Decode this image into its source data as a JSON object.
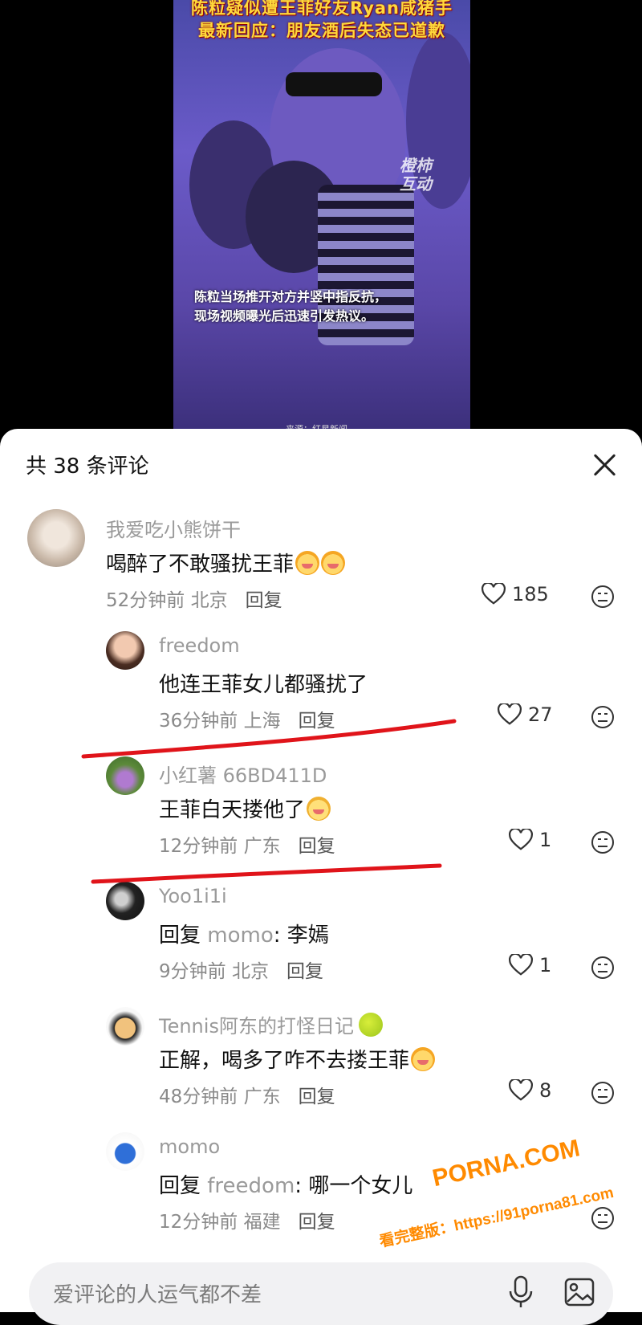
{
  "video": {
    "headline_1": "陈粒疑似遭王菲好友Ryan咸猪手",
    "headline_2": "最新回应：朋友酒后失态已道歉",
    "caption_1": "陈粒当场推开对方并竖中指反抗，",
    "caption_2": "现场视频曝光后迅速引发热议。",
    "watermark_1": "橙柿",
    "watermark_2": "互动",
    "source": "来源：红星新闻"
  },
  "sheet": {
    "title": "共 38 条评论",
    "close_icon": "close-icon"
  },
  "comments": [
    {
      "user": "我爱吃小熊饼干",
      "text": "喝醉了不敢骚扰王菲",
      "time": "52分钟前",
      "location": "北京",
      "reply": "回复",
      "likes": "185",
      "emoji_count": 2
    },
    {
      "user": "freedom",
      "text": "他连王菲女儿都骚扰了",
      "time": "36分钟前",
      "location": "上海",
      "reply": "回复",
      "likes": "27"
    },
    {
      "user": "小红薯 66BD411D",
      "text": "王菲白天搂他了",
      "time": "12分钟前",
      "location": "广东",
      "reply": "回复",
      "likes": "1"
    },
    {
      "user": "Yoo1i1i",
      "reply_prefix": "回复",
      "reply_target": "momo",
      "text": ": 李嫣",
      "time": "9分钟前",
      "location": "北京",
      "reply": "回复",
      "likes": "1"
    },
    {
      "user": "Tennis阿东的打怪日记",
      "text": "正解，喝多了咋不去搂王菲",
      "time": "48分钟前",
      "location": "广东",
      "reply": "回复",
      "likes": "8"
    },
    {
      "user": "momo",
      "reply_prefix": "回复",
      "reply_target": "freedom",
      "text": ": 哪一个女儿",
      "time": "12分钟前",
      "location": "福建",
      "reply": "回复"
    }
  ],
  "input": {
    "placeholder": "爱评论的人运气都不差"
  },
  "watermark": {
    "site": "PORNA.COM",
    "line": "看完整版：https://91porna81.com"
  },
  "colors": {
    "annotation_red": "#e0141a",
    "watermark_orange": "#ff8a00"
  }
}
